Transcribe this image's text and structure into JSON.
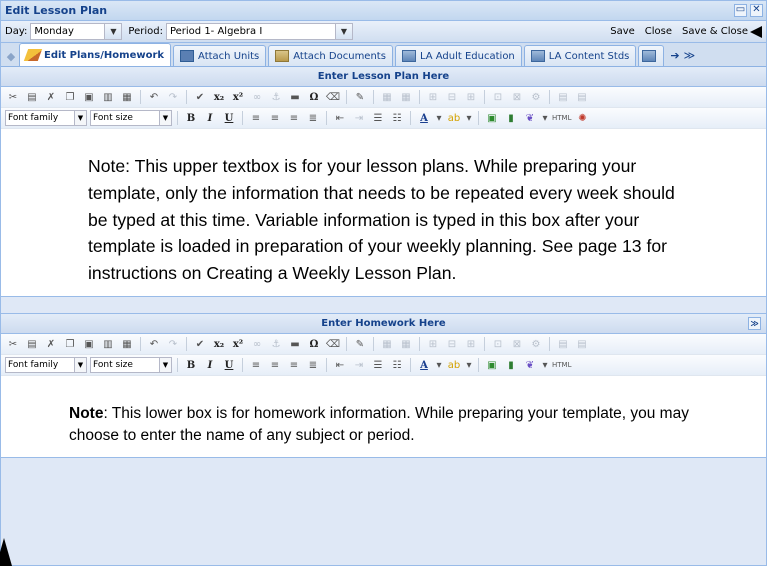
{
  "window": {
    "title": "Edit Lesson Plan",
    "controls": [
      "restore",
      "close"
    ]
  },
  "toolbar": {
    "day_label": "Day:",
    "day_value": "Monday",
    "period_label": "Period:",
    "period_value": "Period 1- Algebra I",
    "save_label": "Save",
    "close_label": "Close",
    "save_close_label": "Save & Close"
  },
  "tabs": [
    {
      "label": "Edit Plans/Homework",
      "icon": "pencil-icon",
      "active": true
    },
    {
      "label": "Attach Units",
      "icon": "board-icon",
      "active": false
    },
    {
      "label": "Attach Documents",
      "icon": "folder-icon",
      "active": false
    },
    {
      "label": "LA Adult Education",
      "icon": "standards-icon",
      "active": false
    },
    {
      "label": "LA Content Stds",
      "icon": "standards-icon",
      "active": false
    }
  ],
  "editor_toolbar": {
    "font_family": "Font family",
    "font_size": "Font size",
    "html_label": "HTML"
  },
  "lesson_panel": {
    "header": "Enter Lesson Plan Here",
    "text": "Note:  This upper textbox is for your lesson plans.  While preparing your template, only the information that needs to be repeated every week should be typed at this time.  Variable information is typed in this box after your template is loaded in preparation of your weekly planning.  See page 13 for instructions on Creating a Weekly Lesson Plan."
  },
  "homework_panel": {
    "header": "Enter Homework Here",
    "note_label": "Note",
    "text": ":  This lower box is for homework information.  While preparing your template, you may choose to enter the name of any subject or period."
  },
  "colors": {
    "panel_border": "#99bbe8",
    "header_text": "#15428b",
    "window_bg": "#dfe8f6"
  }
}
